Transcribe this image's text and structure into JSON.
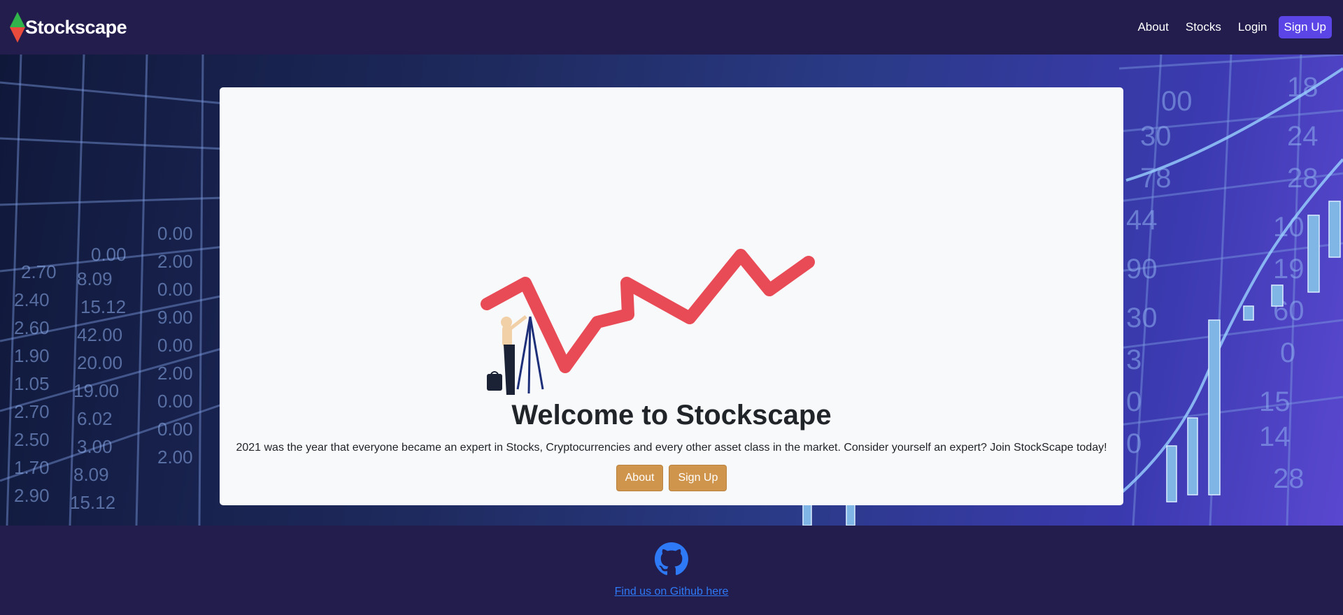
{
  "navbar": {
    "brand": "Stockscape",
    "links": [
      "About",
      "Stocks",
      "Login"
    ],
    "signup": "Sign Up"
  },
  "hero": {
    "title": "Welcome to Stockscape",
    "text": "2021 was the year that everyone became an expert in Stocks, Cryptocurrencies and every other asset class in the market. Consider yourself an expert? Join StockScape today!",
    "buttons": [
      "About",
      "Sign Up"
    ]
  },
  "footer": {
    "link_text": "Find us on Github here",
    "icon": "github-icon"
  },
  "colors": {
    "nav_bg": "#231d4e",
    "signup_bg": "#5b45e6",
    "hero_button": "#d0954c",
    "chart_line": "#e84b55",
    "link": "#2e79f5"
  }
}
